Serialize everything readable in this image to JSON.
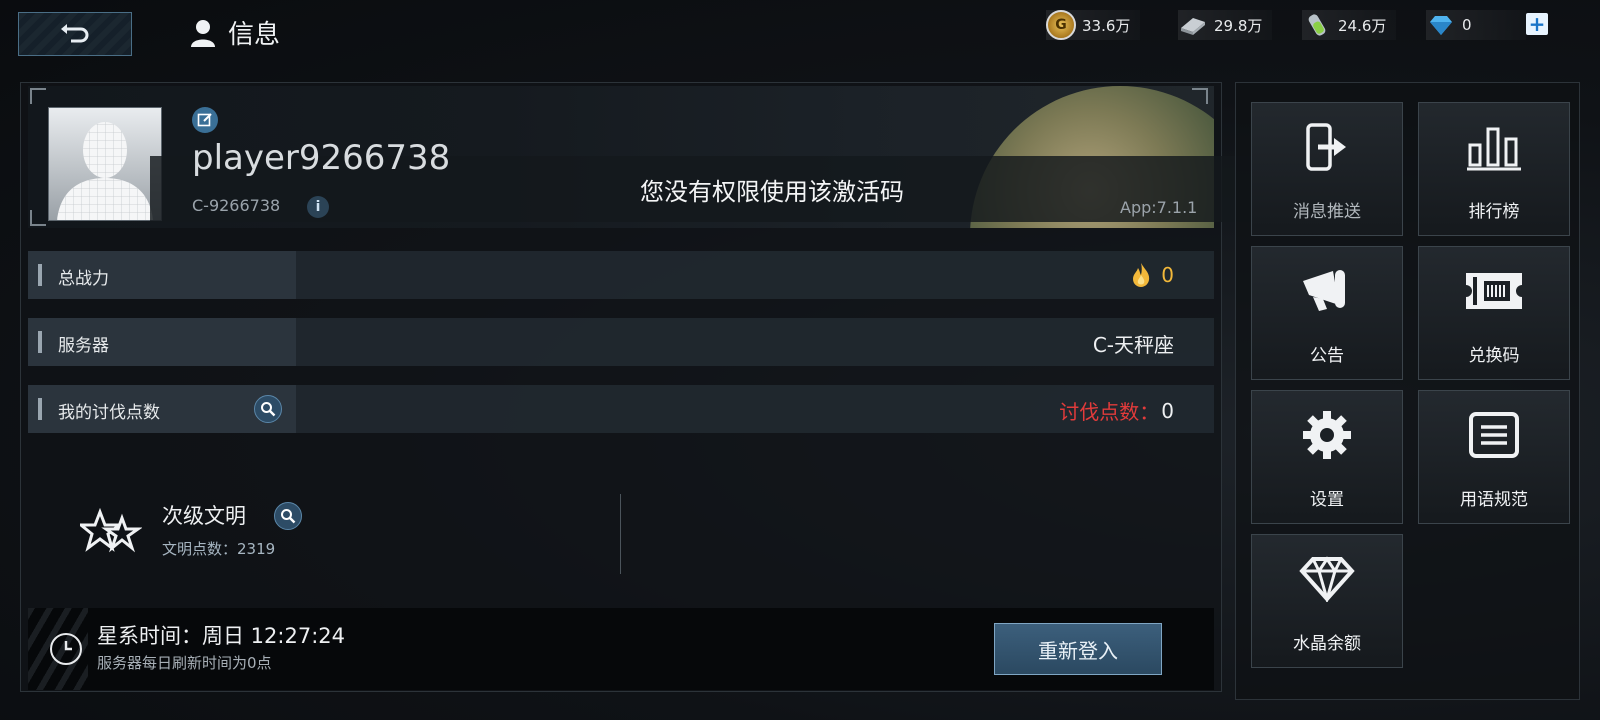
{
  "header": {
    "title": "信息",
    "back_icon": "back-arrow-icon"
  },
  "resources": [
    {
      "name": "gold",
      "value": "33.6万",
      "icon": "gold-coin-icon"
    },
    {
      "name": "alloy",
      "value": "29.8万",
      "icon": "alloy-icon"
    },
    {
      "name": "fuel",
      "value": "24.6万",
      "icon": "fuel-icon"
    },
    {
      "name": "crystal",
      "value": "0",
      "icon": "diamond-icon"
    }
  ],
  "profile": {
    "player_name": "player9266738",
    "player_id": "C-9266738",
    "app_version": "App:7.1.1",
    "toast": "您没有权限使用该激活码"
  },
  "stats": {
    "power_label": "总战力",
    "power_value": "0",
    "server_label": "服务器",
    "server_value": "C-天秤座",
    "crusade_label": "我的讨伐点数",
    "crusade_value_label": "讨伐点数：",
    "crusade_value": "0"
  },
  "civilization": {
    "title": "次级文明",
    "points_label": "文明点数：2319"
  },
  "footer": {
    "galaxy_time": "星系时间：周日 12:27:24",
    "refresh_note": "服务器每日刷新时间为0点",
    "relogin_label": "重新登入"
  },
  "menu": [
    {
      "label": "消息推送",
      "icon": "logout-icon"
    },
    {
      "label": "排行榜",
      "icon": "leaderboard-icon"
    },
    {
      "label": "公告",
      "icon": "megaphone-icon"
    },
    {
      "label": "兑换码",
      "icon": "ticket-icon"
    },
    {
      "label": "设置",
      "icon": "gear-icon"
    },
    {
      "label": "用语规范",
      "icon": "document-icon"
    },
    {
      "label": "水晶余额",
      "icon": "diamond-icon"
    }
  ],
  "colors": {
    "accent_blue": "#3a6f96",
    "crusade_red": "#e23b3b",
    "power_gold": "#f2b83a"
  }
}
